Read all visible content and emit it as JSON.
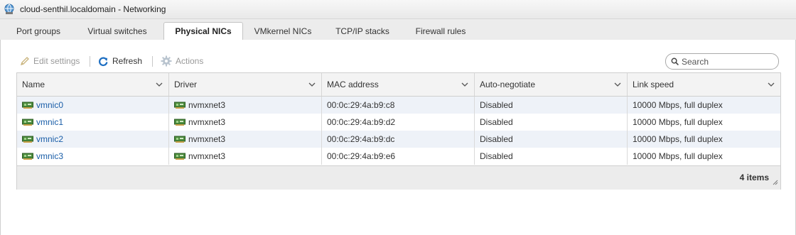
{
  "window": {
    "title": "cloud-senthil.localdomain - Networking",
    "icon": "networking-globe-icon"
  },
  "tabs": [
    {
      "label": "Port groups",
      "active": false
    },
    {
      "label": "Virtual switches",
      "active": false
    },
    {
      "label": "Physical NICs",
      "active": true
    },
    {
      "label": "VMkernel NICs",
      "active": false
    },
    {
      "label": "TCP/IP stacks",
      "active": false
    },
    {
      "label": "Firewall rules",
      "active": false
    }
  ],
  "toolbar": {
    "edit_settings": {
      "label": "Edit settings",
      "icon": "pencil-icon",
      "enabled": false
    },
    "refresh": {
      "label": "Refresh",
      "icon": "refresh-icon",
      "enabled": true
    },
    "actions": {
      "label": "Actions",
      "icon": "gear-icon",
      "enabled": false
    }
  },
  "search": {
    "placeholder": "Search",
    "value": ""
  },
  "table": {
    "columns": [
      "Name",
      "Driver",
      "MAC address",
      "Auto-negotiate",
      "Link speed"
    ],
    "rows": [
      {
        "name": "vmnic0",
        "driver": "nvmxnet3",
        "mac": "00:0c:29:4a:b9:c8",
        "auto": "Disabled",
        "speed": "10000 Mbps, full duplex"
      },
      {
        "name": "vmnic1",
        "driver": "nvmxnet3",
        "mac": "00:0c:29:4a:b9:d2",
        "auto": "Disabled",
        "speed": "10000 Mbps, full duplex"
      },
      {
        "name": "vmnic2",
        "driver": "nvmxnet3",
        "mac": "00:0c:29:4a:b9:dc",
        "auto": "Disabled",
        "speed": "10000 Mbps, full duplex"
      },
      {
        "name": "vmnic3",
        "driver": "nvmxnet3",
        "mac": "00:0c:29:4a:b9:e6",
        "auto": "Disabled",
        "speed": "10000 Mbps, full duplex"
      }
    ],
    "footer": {
      "count": "4 items"
    }
  },
  "colors": {
    "link": "#1a5ea8",
    "accent": "#1e6fc2",
    "row_stripe": "#eef2f8",
    "nic_icon": "#4a8a3c"
  }
}
